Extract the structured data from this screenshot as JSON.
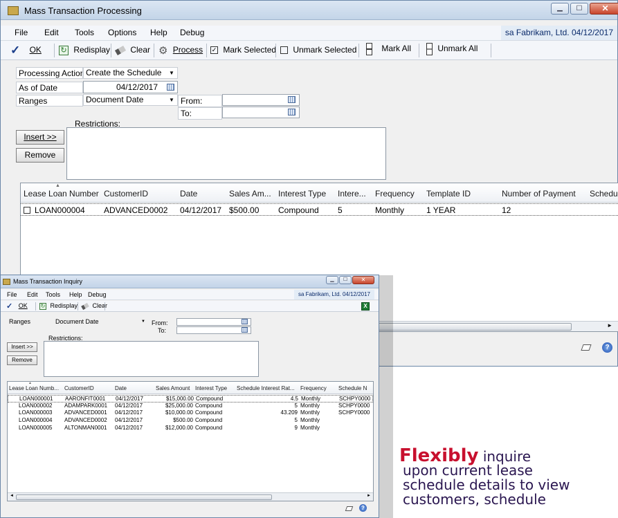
{
  "main": {
    "title": "Mass Transaction Processing",
    "menus": [
      "File",
      "Edit",
      "Tools",
      "Options",
      "Help",
      "Debug"
    ],
    "user": "sa  Fabrikam, Ltd.  04/12/2017",
    "toolbar": {
      "ok": "OK",
      "redisplay": "Redisplay",
      "clear": "Clear",
      "process": "Process",
      "mark_selected": "Mark Selected",
      "unmark_selected": "Unmark Selected",
      "mark_all": "Mark All",
      "unmark_all": "Unmark All"
    },
    "form": {
      "processing_action_label": "Processing Action",
      "processing_action_value": "Create the Schedule",
      "as_of_date_label": "As of Date",
      "as_of_date_value": "04/12/2017",
      "ranges_label": "Ranges",
      "ranges_value": "Document Date",
      "from_label": "From:",
      "to_label": "To:",
      "restrictions_label": "Restrictions:",
      "insert_label": "Insert >>",
      "remove_label": "Remove"
    },
    "columns": [
      "Lease Loan Number",
      "CustomerID",
      "Date",
      "Sales Am...",
      "Interest Type",
      "Intere...",
      "Frequency",
      "Template ID",
      "Number of Payment",
      "Schedu"
    ],
    "rows": [
      [
        "LOAN000004",
        "ADVANCED0002",
        "04/12/2017",
        "$500.00",
        "Compound",
        "5",
        "Monthly",
        "1 YEAR",
        "12"
      ]
    ]
  },
  "inquiry": {
    "title": "Mass Transaction Inquiry",
    "menus": [
      "File",
      "Edit",
      "Tools",
      "Help",
      "Debug"
    ],
    "user": "sa  Fabrikam, Ltd.  04/12/2017",
    "toolbar": {
      "ok": "OK",
      "redisplay": "Redisplay",
      "clear": "Clear"
    },
    "form": {
      "ranges_label": "Ranges",
      "ranges_value": "Document Date",
      "from_label": "From:",
      "to_label": "To:",
      "restrictions_label": "Restrictions:",
      "insert_label": "Insert >>",
      "remove_label": "Remove"
    },
    "columns": [
      "Lease Loan Numb...",
      "CustomerID",
      "Date",
      "Sales Amount",
      "Interest Type",
      "Schedule Interest Rat...",
      "Frequency",
      "Schedule N"
    ],
    "rows": [
      [
        "LOAN000001",
        "AARONFIT0001",
        "04/12/2017",
        "$15,000.00",
        "Compound",
        "4.5",
        "Monthly",
        "SCHPY0000"
      ],
      [
        "LOAN000002",
        "ADAMPARK0001",
        "04/12/2017",
        "$25,000.00",
        "Compound",
        "5",
        "Monthly",
        "SCHPY0000"
      ],
      [
        "LOAN000003",
        "ADVANCED0001",
        "04/12/2017",
        "$10,000.00",
        "Compound",
        "43.209",
        "Monthly",
        "SCHPY0000"
      ],
      [
        "LOAN000004",
        "ADVANCED0002",
        "04/12/2017",
        "$500.00",
        "Compound",
        "5",
        "Monthly",
        ""
      ],
      [
        "LOAN000005",
        "ALTONMAN0001",
        "04/12/2017",
        "$12,000.00",
        "Compound",
        "9",
        "Monthly",
        ""
      ]
    ]
  },
  "promo": {
    "big": "Flexibly",
    "line1": " inquire",
    "line2": "upon current lease",
    "line3": "schedule details to view",
    "line4": "customers, schedule"
  },
  "colors": {
    "accent": "#c8102e",
    "titlebar": "#c3d4e8"
  },
  "icons": [
    "checkmark-icon",
    "redisplay-icon",
    "clear-icon",
    "process-icon",
    "excel-icon",
    "note-icon",
    "help-icon"
  ]
}
